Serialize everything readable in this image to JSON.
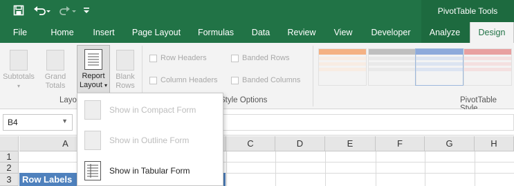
{
  "titlebar": {
    "tools_title": "PivotTable Tools",
    "save_icon": "save-icon",
    "undo_icon": "undo-icon",
    "redo_icon": "redo-icon",
    "customize_icon": "customize-qat-icon"
  },
  "tabs": [
    {
      "label": "File"
    },
    {
      "label": "Home"
    },
    {
      "label": "Insert"
    },
    {
      "label": "Page Layout"
    },
    {
      "label": "Formulas"
    },
    {
      "label": "Data"
    },
    {
      "label": "Review"
    },
    {
      "label": "View"
    },
    {
      "label": "Developer"
    },
    {
      "label": "Analyze"
    },
    {
      "label": "Design"
    }
  ],
  "ribbon": {
    "layout": {
      "subtotals": "Subtotals",
      "grand_totals_1": "Grand",
      "grand_totals_2": "Totals",
      "report_layout_1": "Report",
      "report_layout_2": "Layout",
      "blank_rows_1": "Blank",
      "blank_rows_2": "Rows",
      "group_label": "Layou"
    },
    "style_options": {
      "row_headers": "Row Headers",
      "column_headers": "Column Headers",
      "banded_rows": "Banded Rows",
      "banded_columns": "Banded Columns",
      "group_label": "Style Options"
    },
    "styles": {
      "group_label": "PivotTable Style"
    }
  },
  "formula_bar": {
    "name_box": "B4"
  },
  "grid": {
    "columns": [
      "A",
      "B",
      "C",
      "D",
      "E",
      "F",
      "G",
      "H"
    ],
    "rows": [
      "1",
      "2",
      "3"
    ],
    "cell_a3": "Row Labels"
  },
  "dropdown": {
    "items": [
      {
        "label": "Show in Compact Form"
      },
      {
        "label": "Show in Outline Form"
      },
      {
        "label": "Show in Tabular Form"
      }
    ]
  },
  "colors": {
    "excel_green": "#217346",
    "pivot_header_blue": "#4f81bd"
  }
}
